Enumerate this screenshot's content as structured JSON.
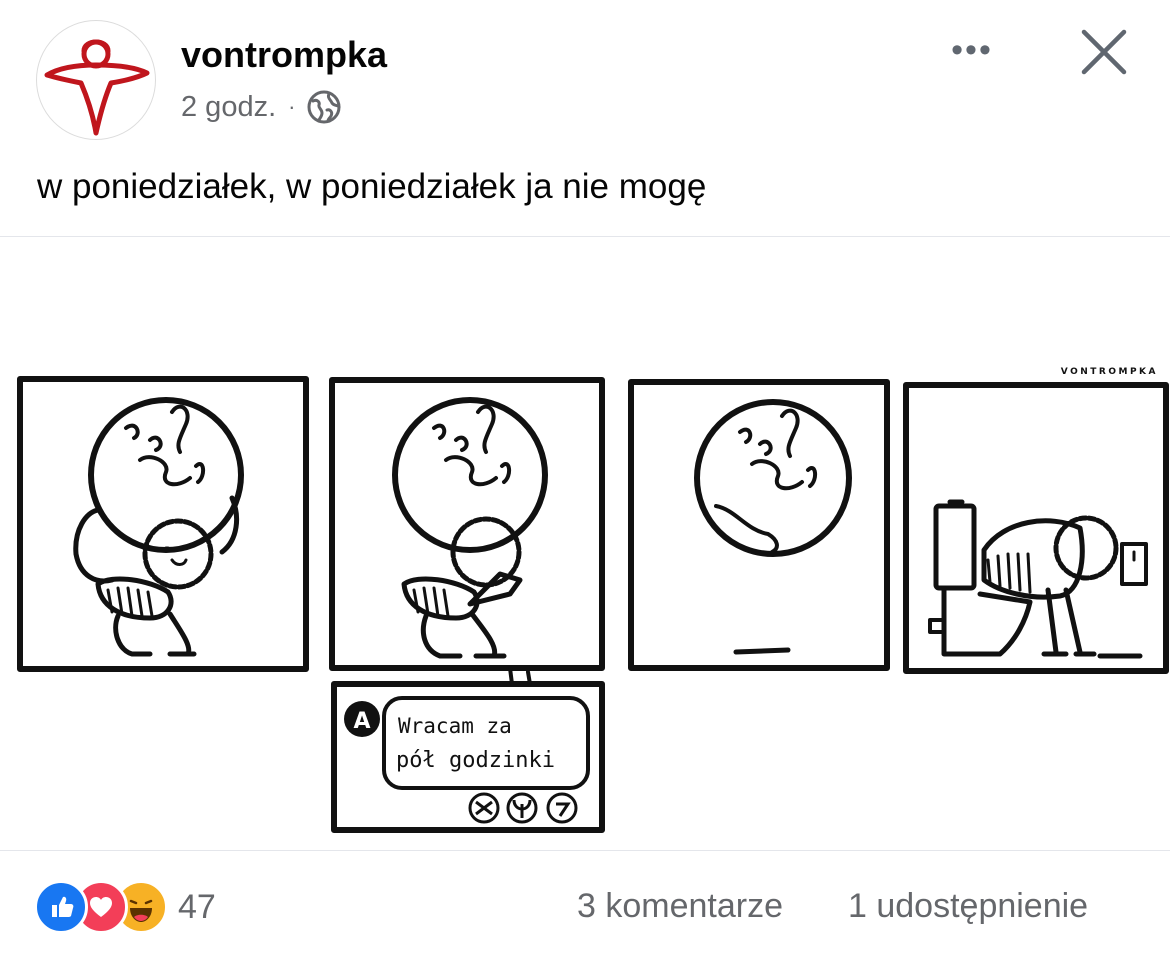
{
  "post": {
    "author": "vontrompka",
    "time": "2 godz.",
    "separator": "·",
    "text": "w poniedziałek, w poniedziałek ja nie mogę"
  },
  "header": {
    "more_label": "•••",
    "close_icon": "close-icon",
    "privacy_icon": "globe-icon"
  },
  "comic": {
    "signature": "VONTROMPKA",
    "speech_line1": "Wracam za",
    "speech_line2": "pół godzinki",
    "app_badge": "A"
  },
  "footer": {
    "reaction_icons": [
      "like-icon",
      "love-icon",
      "haha-icon"
    ],
    "reaction_count": "47",
    "comments_label": "3 komentarze",
    "shares_label": "1 udostępnienie"
  },
  "colors": {
    "brand_blue": "#1877f2",
    "love_red": "#f33e58",
    "haha_yellow": "#f7b125",
    "avatar_red": "#c0161d",
    "meta_gray": "#65676b"
  }
}
